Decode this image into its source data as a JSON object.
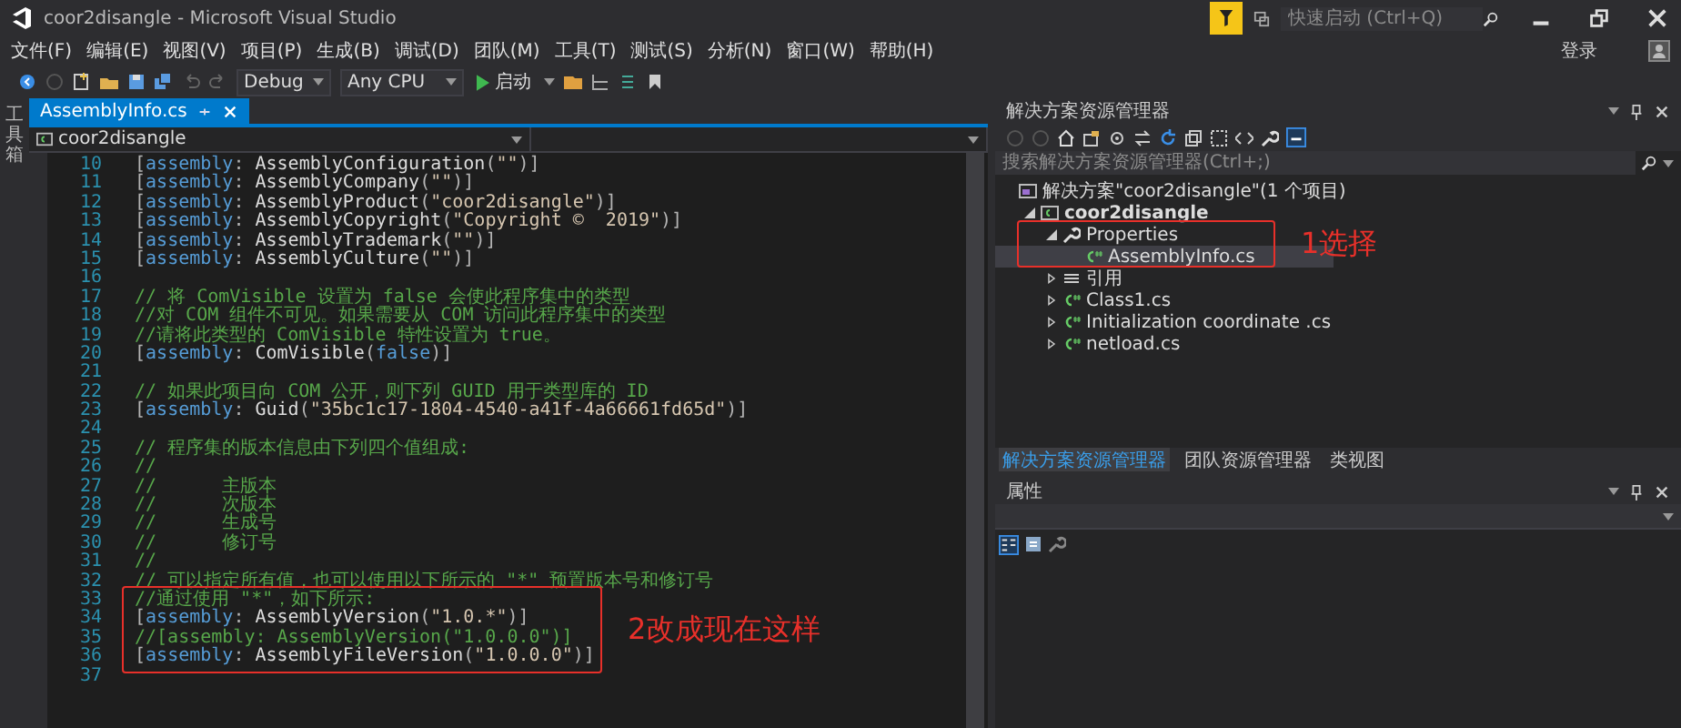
{
  "window": {
    "title": "coor2disangle - Microsoft Visual Studio",
    "quick_launch": {
      "placeholder": "快速启动 (Ctrl+Q)"
    },
    "sign_in": "登录"
  },
  "menu": [
    "文件(F)",
    "编辑(E)",
    "视图(V)",
    "项目(P)",
    "生成(B)",
    "调试(D)",
    "团队(M)",
    "工具(T)",
    "测试(S)",
    "分析(N)",
    "窗口(W)",
    "帮助(H)"
  ],
  "toolbar": {
    "configuration": "Debug",
    "platform": "Any CPU",
    "start": "启动"
  },
  "toolbox_strip": "工具箱",
  "editor": {
    "tabs": [
      {
        "label": "AssemblyInfo.cs",
        "selected": true
      }
    ],
    "nav_project": "coor2disangle",
    "lines": [
      {
        "number": "10",
        "tokens": [
          {
            "kind": "punct",
            "text": "["
          },
          {
            "kind": "keyword",
            "text": "assembly"
          },
          {
            "kind": "punct",
            "text": ": "
          },
          {
            "kind": "name",
            "text": "AssemblyConfiguration"
          },
          {
            "kind": "punct",
            "text": "("
          },
          {
            "kind": "string",
            "text": "\"\""
          },
          {
            "kind": "punct",
            "text": ")]"
          }
        ]
      },
      {
        "number": "11",
        "tokens": [
          {
            "kind": "punct",
            "text": "["
          },
          {
            "kind": "keyword",
            "text": "assembly"
          },
          {
            "kind": "punct",
            "text": ": "
          },
          {
            "kind": "name",
            "text": "AssemblyCompany"
          },
          {
            "kind": "punct",
            "text": "("
          },
          {
            "kind": "string",
            "text": "\"\""
          },
          {
            "kind": "punct",
            "text": ")]"
          }
        ]
      },
      {
        "number": "12",
        "tokens": [
          {
            "kind": "punct",
            "text": "["
          },
          {
            "kind": "keyword",
            "text": "assembly"
          },
          {
            "kind": "punct",
            "text": ": "
          },
          {
            "kind": "name",
            "text": "AssemblyProduct"
          },
          {
            "kind": "punct",
            "text": "("
          },
          {
            "kind": "string",
            "text": "\"coor2disangle\""
          },
          {
            "kind": "punct",
            "text": ")]"
          }
        ]
      },
      {
        "number": "13",
        "tokens": [
          {
            "kind": "punct",
            "text": "["
          },
          {
            "kind": "keyword",
            "text": "assembly"
          },
          {
            "kind": "punct",
            "text": ": "
          },
          {
            "kind": "name",
            "text": "AssemblyCopyright"
          },
          {
            "kind": "punct",
            "text": "("
          },
          {
            "kind": "string",
            "text": "\"Copyright ©  2019\""
          },
          {
            "kind": "punct",
            "text": ")]"
          }
        ]
      },
      {
        "number": "14",
        "tokens": [
          {
            "kind": "punct",
            "text": "["
          },
          {
            "kind": "keyword",
            "text": "assembly"
          },
          {
            "kind": "punct",
            "text": ": "
          },
          {
            "kind": "name",
            "text": "AssemblyTrademark"
          },
          {
            "kind": "punct",
            "text": "("
          },
          {
            "kind": "string",
            "text": "\"\""
          },
          {
            "kind": "punct",
            "text": ")]"
          }
        ]
      },
      {
        "number": "15",
        "tokens": [
          {
            "kind": "punct",
            "text": "["
          },
          {
            "kind": "keyword",
            "text": "assembly"
          },
          {
            "kind": "punct",
            "text": ": "
          },
          {
            "kind": "name",
            "text": "AssemblyCulture"
          },
          {
            "kind": "punct",
            "text": "("
          },
          {
            "kind": "string",
            "text": "\"\""
          },
          {
            "kind": "punct",
            "text": ")]"
          }
        ]
      },
      {
        "number": "16"
      },
      {
        "number": "17",
        "tokens": [
          {
            "kind": "comment",
            "text": "// 将 ComVisible 设置为 false 会使此程序集中的类型"
          }
        ]
      },
      {
        "number": "18",
        "tokens": [
          {
            "kind": "comment",
            "text": "//对 COM 组件不可见。如果需要从 COM 访问此程序集中的类型"
          }
        ]
      },
      {
        "number": "19",
        "tokens": [
          {
            "kind": "comment",
            "text": "//请将此类型的 ComVisible 特性设置为 true。"
          }
        ]
      },
      {
        "number": "20",
        "tokens": [
          {
            "kind": "punct",
            "text": "["
          },
          {
            "kind": "keyword",
            "text": "assembly"
          },
          {
            "kind": "punct",
            "text": ": "
          },
          {
            "kind": "name",
            "text": "ComVisible"
          },
          {
            "kind": "punct",
            "text": "("
          },
          {
            "kind": "keyword",
            "text": "false"
          },
          {
            "kind": "punct",
            "text": ")]"
          }
        ]
      },
      {
        "number": "21"
      },
      {
        "number": "22",
        "tokens": [
          {
            "kind": "comment",
            "text": "// 如果此项目向 COM 公开，则下列 GUID 用于类型库的 ID"
          }
        ]
      },
      {
        "number": "23",
        "tokens": [
          {
            "kind": "punct",
            "text": "["
          },
          {
            "kind": "keyword",
            "text": "assembly"
          },
          {
            "kind": "punct",
            "text": ": "
          },
          {
            "kind": "name",
            "text": "Guid"
          },
          {
            "kind": "punct",
            "text": "("
          },
          {
            "kind": "string",
            "text": "\"35bc1c17-1804-4540-a41f-4a66661fd65d\""
          },
          {
            "kind": "punct",
            "text": ")]"
          }
        ]
      },
      {
        "number": "24"
      },
      {
        "number": "25",
        "tokens": [
          {
            "kind": "comment",
            "text": "// 程序集的版本信息由下列四个值组成:"
          }
        ]
      },
      {
        "number": "26",
        "tokens": [
          {
            "kind": "comment",
            "text": "//"
          }
        ]
      },
      {
        "number": "27",
        "tokens": [
          {
            "kind": "comment",
            "text": "//      主版本"
          }
        ]
      },
      {
        "number": "28",
        "tokens": [
          {
            "kind": "comment",
            "text": "//      次版本"
          }
        ]
      },
      {
        "number": "29",
        "tokens": [
          {
            "kind": "comment",
            "text": "//      生成号"
          }
        ]
      },
      {
        "number": "30",
        "tokens": [
          {
            "kind": "comment",
            "text": "//      修订号"
          }
        ]
      },
      {
        "number": "31",
        "tokens": [
          {
            "kind": "comment",
            "text": "//"
          }
        ]
      },
      {
        "number": "32",
        "tokens": [
          {
            "kind": "comment",
            "text": "// 可以指定所有值，也可以使用以下所示的 \"*\" 预置版本号和修订号"
          }
        ]
      },
      {
        "number": "33",
        "tokens": [
          {
            "kind": "comment",
            "text": "//通过使用 \"*\"，如下所示:"
          }
        ]
      },
      {
        "number": "34",
        "tokens": [
          {
            "kind": "punct",
            "text": "["
          },
          {
            "kind": "keyword",
            "text": "assembly"
          },
          {
            "kind": "punct",
            "text": ": "
          },
          {
            "kind": "name",
            "text": "AssemblyVersion"
          },
          {
            "kind": "punct",
            "text": "("
          },
          {
            "kind": "string",
            "text": "\"1.0.*\""
          },
          {
            "kind": "punct",
            "text": ")]"
          }
        ]
      },
      {
        "number": "35",
        "tokens": [
          {
            "kind": "comment",
            "text": "//[assembly: AssemblyVersion(\"1.0.0.0\")]"
          }
        ]
      },
      {
        "number": "36",
        "tokens": [
          {
            "kind": "punct",
            "text": "["
          },
          {
            "kind": "keyword",
            "text": "assembly"
          },
          {
            "kind": "punct",
            "text": ": "
          },
          {
            "kind": "name",
            "text": "AssemblyFileVersion"
          },
          {
            "kind": "punct",
            "text": "("
          },
          {
            "kind": "string",
            "text": "\"1.0.0.0\""
          },
          {
            "kind": "punct",
            "text": ")]"
          }
        ]
      },
      {
        "number": "37"
      }
    ],
    "annotation": {
      "text": "2改成现在这样"
    }
  },
  "solution_explorer": {
    "title": "解决方案资源管理器",
    "search": {
      "placeholder": "搜索解决方案资源管理器(Ctrl+;)"
    },
    "tree": [
      {
        "label": "解决方案\"coor2disangle\"(1 个项目)",
        "kind": "solution",
        "selected": false,
        "children": [
          {
            "label": "coor2disangle",
            "kind": "project",
            "expanded": true,
            "selected": false,
            "children": [
              {
                "label": "Properties",
                "kind": "properties",
                "expanded": true,
                "selected": false,
                "children": [
                  {
                    "label": "AssemblyInfo.cs",
                    "kind": "csharp",
                    "selected": true
                  }
                ]
              },
              {
                "label": "引用",
                "kind": "references",
                "expanded": false,
                "selected": false
              },
              {
                "label": "Class1.cs",
                "kind": "csharp",
                "expanded": false,
                "selected": false
              },
              {
                "label": "Initialization coordinate .cs",
                "kind": "csharp",
                "expanded": false,
                "selected": false
              },
              {
                "label": "netload.cs",
                "kind": "csharp",
                "expanded": false,
                "selected": false
              }
            ]
          }
        ]
      }
    ],
    "annotation": {
      "text": "1选择"
    },
    "tabs": [
      {
        "label": "解决方案资源管理器",
        "selected": true
      },
      {
        "label": "团队资源管理器",
        "selected": false
      },
      {
        "label": "类视图",
        "selected": false
      }
    ]
  },
  "properties_panel": {
    "title": "属性"
  }
}
